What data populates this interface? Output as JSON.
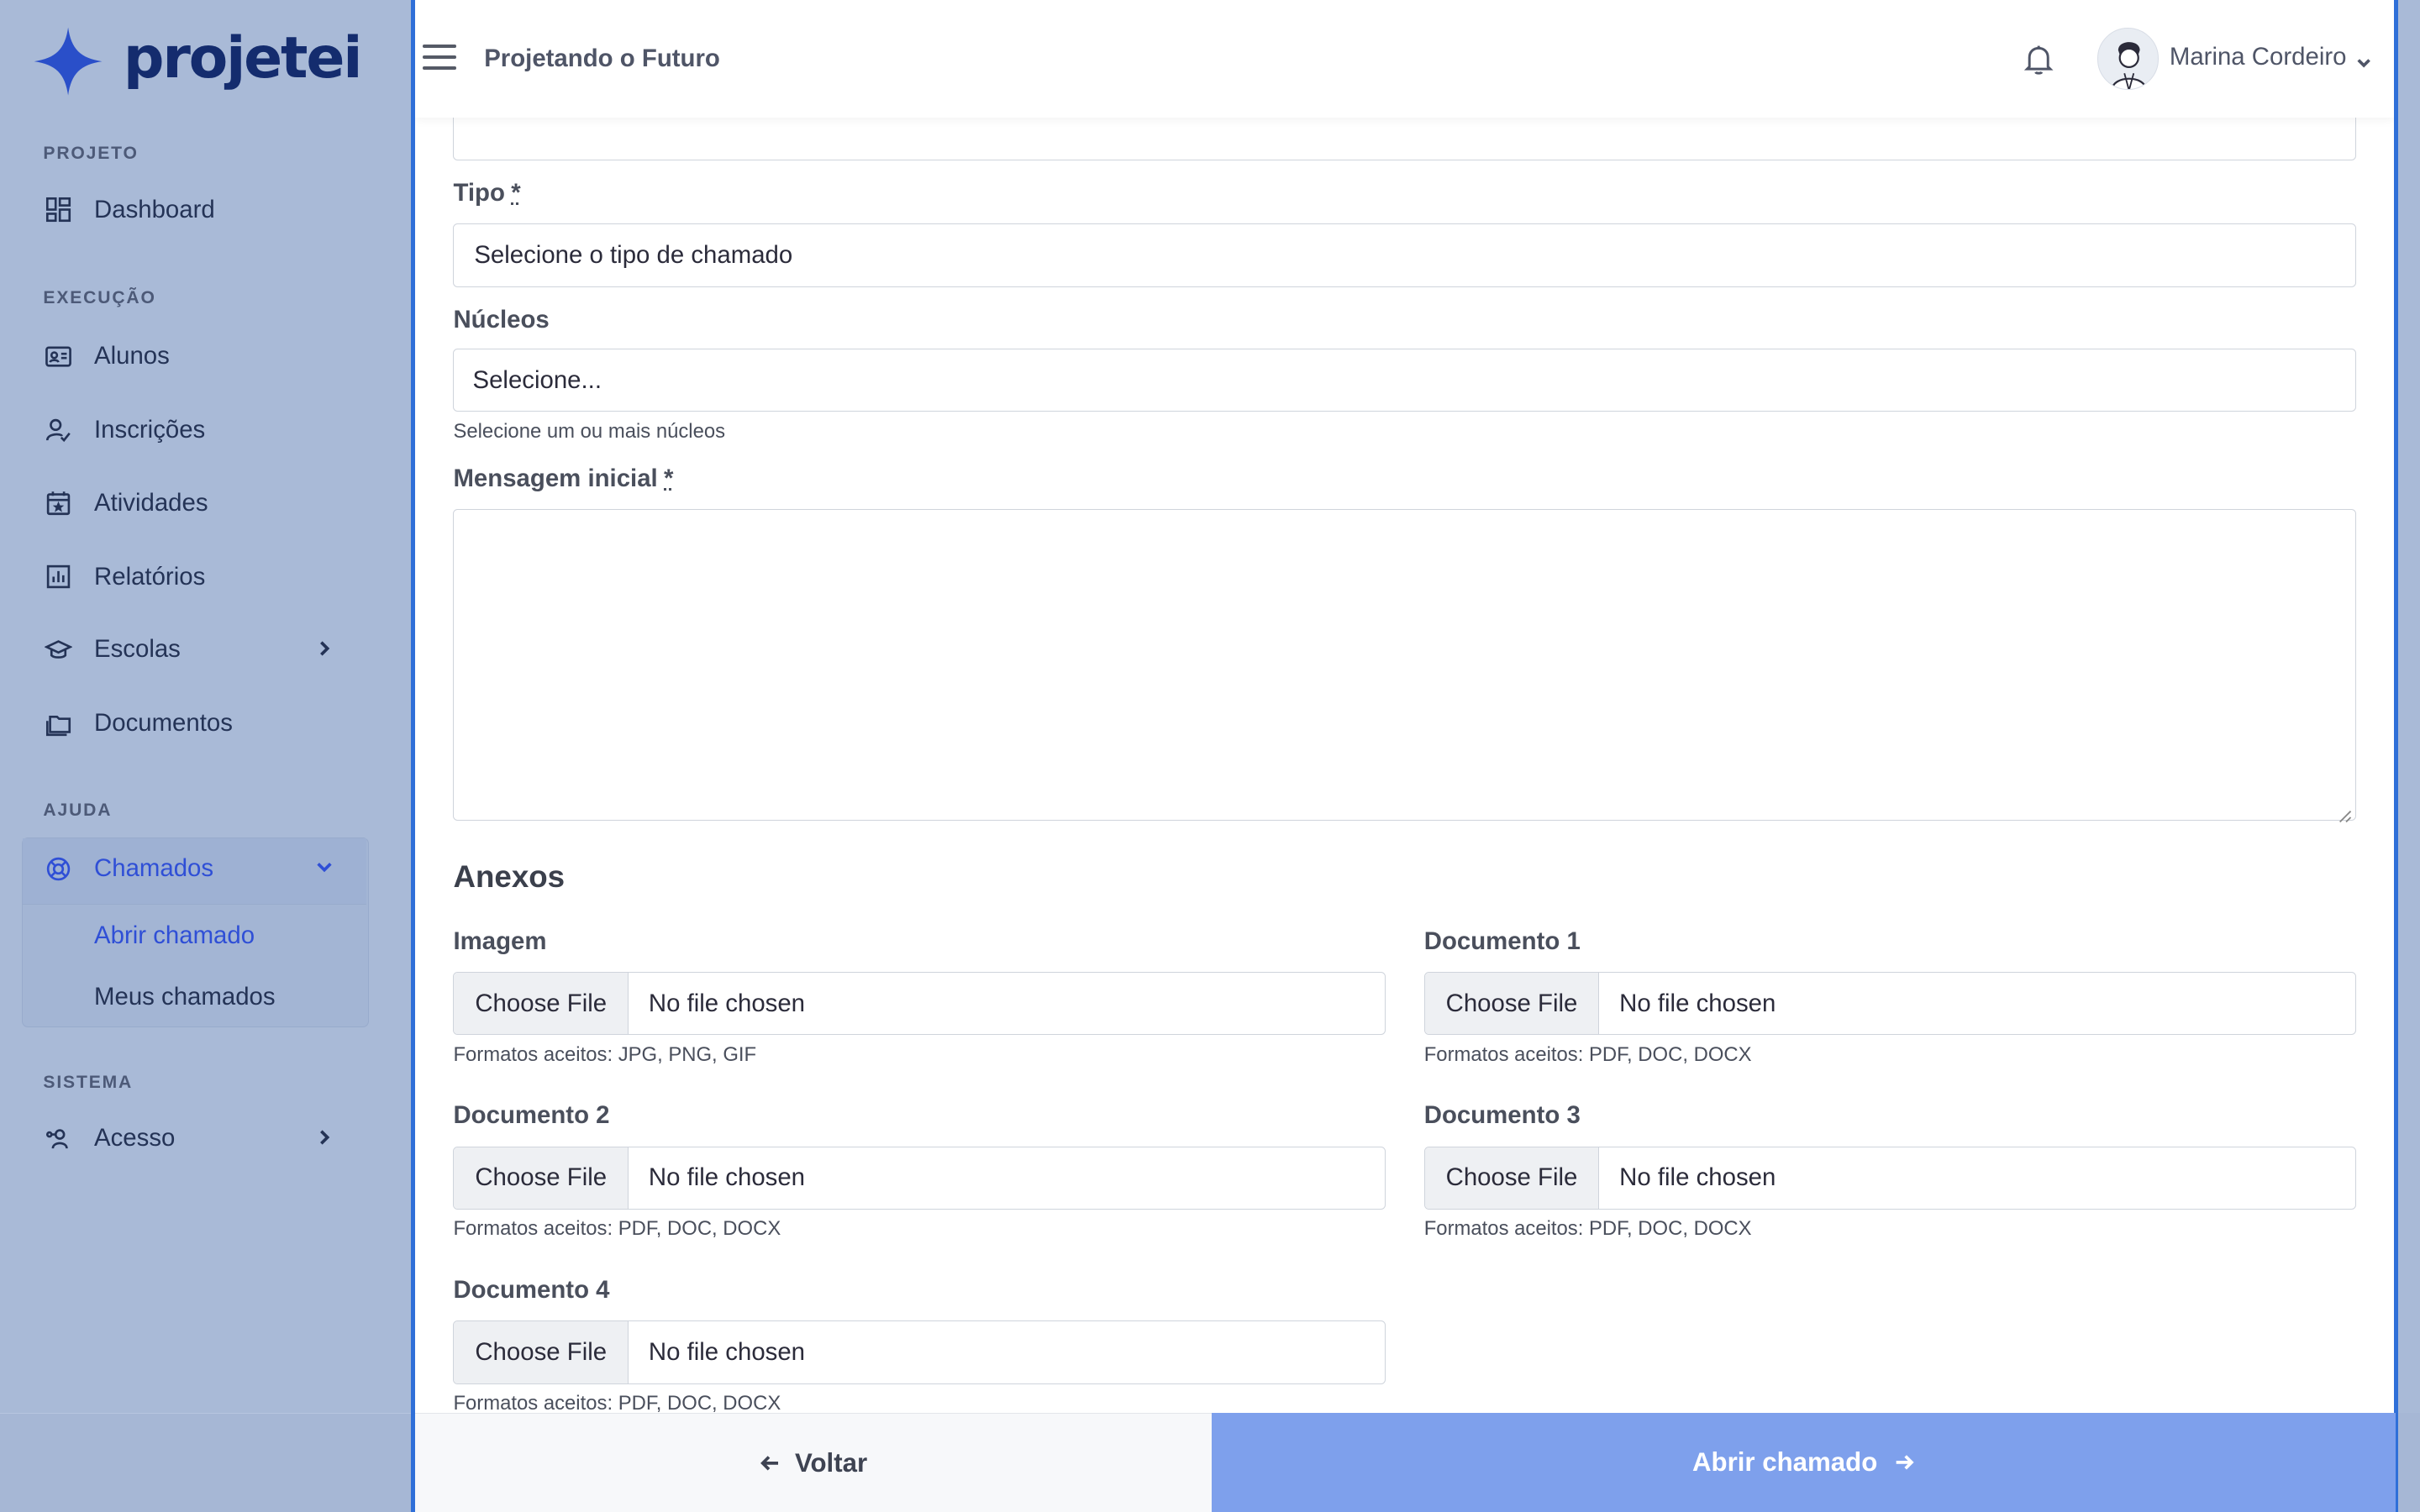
{
  "brand": {
    "name": "projetei",
    "color": "#142c6e",
    "accent": "#2f4fd6"
  },
  "sidebar": {
    "sections": [
      {
        "label": "PROJETO"
      },
      {
        "label": "EXECUÇÃO"
      },
      {
        "label": "AJUDA"
      },
      {
        "label": "SISTEMA"
      }
    ],
    "items": [
      {
        "label": "Dashboard",
        "icon": "dashboard-icon"
      },
      {
        "label": "Alunos",
        "icon": "id-card-icon"
      },
      {
        "label": "Inscrições",
        "icon": "user-check-icon"
      },
      {
        "label": "Atividades",
        "icon": "calendar-star-icon"
      },
      {
        "label": "Relatórios",
        "icon": "bar-chart-icon"
      },
      {
        "label": "Escolas",
        "icon": "graduation-cap-icon",
        "has_children": true
      },
      {
        "label": "Documentos",
        "icon": "folders-icon"
      },
      {
        "label": "Chamados",
        "icon": "lifebuoy-icon",
        "expanded": true,
        "active": true
      },
      {
        "label": "Acesso",
        "icon": "users-key-icon",
        "has_children": true
      }
    ],
    "submenu": [
      {
        "label": "Abrir chamado",
        "active": true
      },
      {
        "label": "Meus chamados"
      }
    ]
  },
  "topbar": {
    "org_name": "Projetando o Futuro",
    "user_name": "Marina Cordeiro"
  },
  "form": {
    "tipo_label": "Tipo",
    "required_mark": "*",
    "tipo_value": "Selecione o tipo de chamado",
    "nucleos_label": "Núcleos",
    "nucleos_value": "Selecione...",
    "nucleos_help": "Selecione um ou mais núcleos",
    "mensagem_label": "Mensagem inicial",
    "anexos_title": "Anexos",
    "file_button": "Choose File",
    "file_empty": "No file chosen",
    "attachments": [
      {
        "label": "Imagem",
        "help": "Formatos aceitos: JPG, PNG, GIF"
      },
      {
        "label": "Documento 1",
        "help": "Formatos aceitos: PDF, DOC, DOCX"
      },
      {
        "label": "Documento 2",
        "help": "Formatos aceitos: PDF, DOC, DOCX"
      },
      {
        "label": "Documento 3",
        "help": "Formatos aceitos: PDF, DOC, DOCX"
      },
      {
        "label": "Documento 4",
        "help": "Formatos aceitos: PDF, DOC, DOCX"
      }
    ]
  },
  "actions": {
    "back_label": "Voltar",
    "submit_label": "Abrir chamado",
    "submit_color": "#7ea0ec"
  }
}
